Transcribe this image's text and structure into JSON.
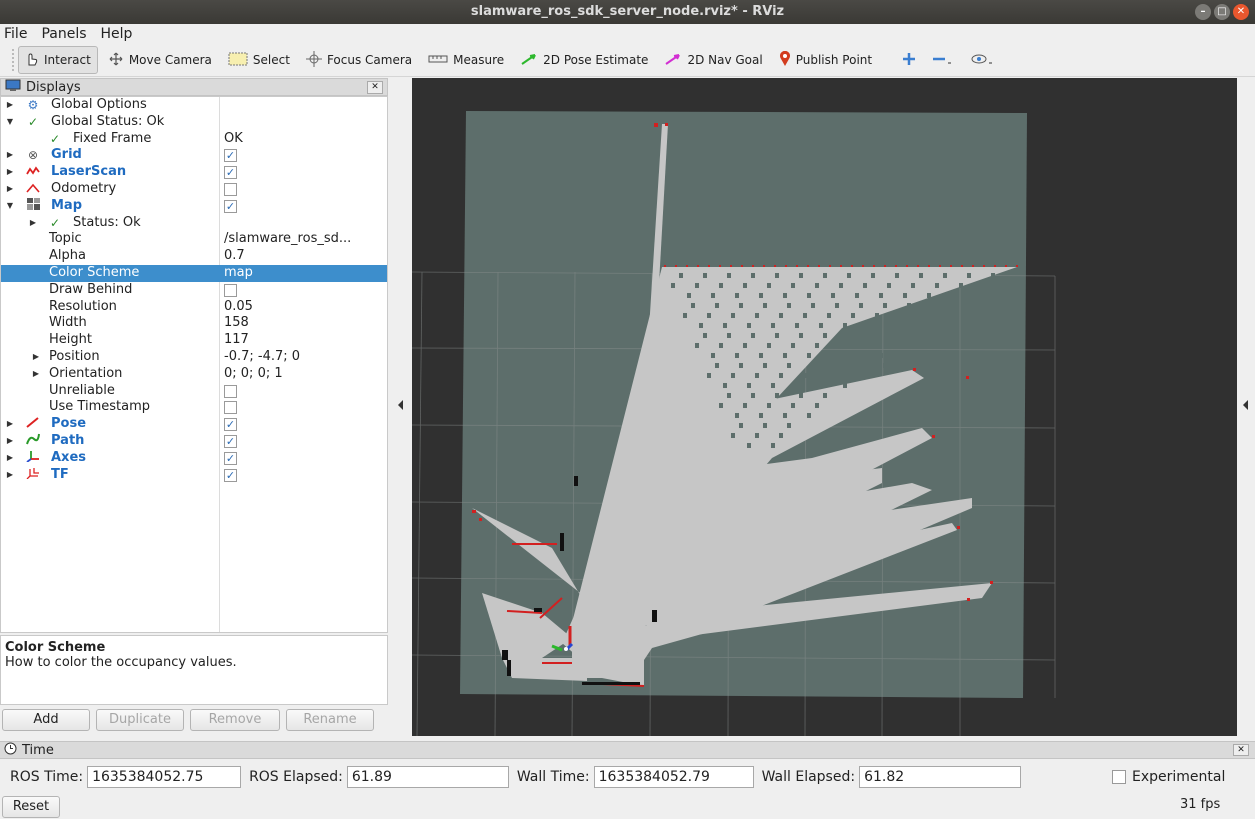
{
  "window": {
    "title": "slamware_ros_sdk_server_node.rviz* - RViz"
  },
  "menubar": {
    "items": [
      "File",
      "Panels",
      "Help"
    ]
  },
  "toolbar": {
    "tools": [
      {
        "label": "Interact",
        "icon": "cursor-icon",
        "active": true
      },
      {
        "label": "Move Camera",
        "icon": "move-camera-icon"
      },
      {
        "label": "Select",
        "icon": "select-icon"
      },
      {
        "label": "Focus Camera",
        "icon": "focus-camera-icon"
      },
      {
        "label": "Measure",
        "icon": "ruler-icon"
      },
      {
        "label": "2D Pose Estimate",
        "icon": "pose-estimate-icon",
        "color": "#2db82d"
      },
      {
        "label": "2D Nav Goal",
        "icon": "nav-goal-icon",
        "color": "#d22fd2"
      },
      {
        "label": "Publish Point",
        "icon": "map-pin-icon",
        "color": "#d23c1e"
      }
    ]
  },
  "displays": {
    "title": "Displays",
    "items": [
      {
        "name": "Global Options",
        "value": ""
      },
      {
        "name": "Global Status: Ok",
        "value": ""
      },
      {
        "name": "Fixed Frame",
        "value": "OK"
      },
      {
        "name": "Grid",
        "checked": true
      },
      {
        "name": "LaserScan",
        "checked": true
      },
      {
        "name": "Odometry",
        "checked": false
      },
      {
        "name": "Map",
        "checked": true
      },
      {
        "name": "Status: Ok",
        "value": ""
      },
      {
        "name": "Topic",
        "value": "/slamware_ros_sd..."
      },
      {
        "name": "Alpha",
        "value": "0.7"
      },
      {
        "name": "Color Scheme",
        "value": "map"
      },
      {
        "name": "Draw Behind",
        "checked": false
      },
      {
        "name": "Resolution",
        "value": "0.05"
      },
      {
        "name": "Width",
        "value": "158"
      },
      {
        "name": "Height",
        "value": "117"
      },
      {
        "name": "Position",
        "value": "-0.7; -4.7; 0"
      },
      {
        "name": "Orientation",
        "value": "0; 0; 0; 1"
      },
      {
        "name": "Unreliable",
        "checked": false
      },
      {
        "name": "Use Timestamp",
        "checked": false
      },
      {
        "name": "Pose",
        "checked": true
      },
      {
        "name": "Path",
        "checked": true
      },
      {
        "name": "Axes",
        "checked": true
      },
      {
        "name": "TF",
        "checked": true
      }
    ],
    "description": {
      "title": "Color Scheme",
      "text": "How to color the occupancy values."
    },
    "buttons": [
      "Add",
      "Duplicate",
      "Remove",
      "Rename"
    ]
  },
  "time": {
    "title": "Time",
    "ros_time_label": "ROS Time:",
    "ros_time": "1635384052.75",
    "ros_elapsed_label": "ROS Elapsed:",
    "ros_elapsed": "61.89",
    "wall_time_label": "Wall Time:",
    "wall_time": "1635384052.79",
    "wall_elapsed_label": "Wall Elapsed:",
    "wall_elapsed": "61.82",
    "experimental_label": "Experimental",
    "reset_label": "Reset",
    "fps": "31 fps"
  },
  "colors": {
    "selection": "#3d8ecc",
    "map_unknown": "#5d6e6b",
    "map_free": "#c4c4c4",
    "viewport_bg": "#303030"
  }
}
